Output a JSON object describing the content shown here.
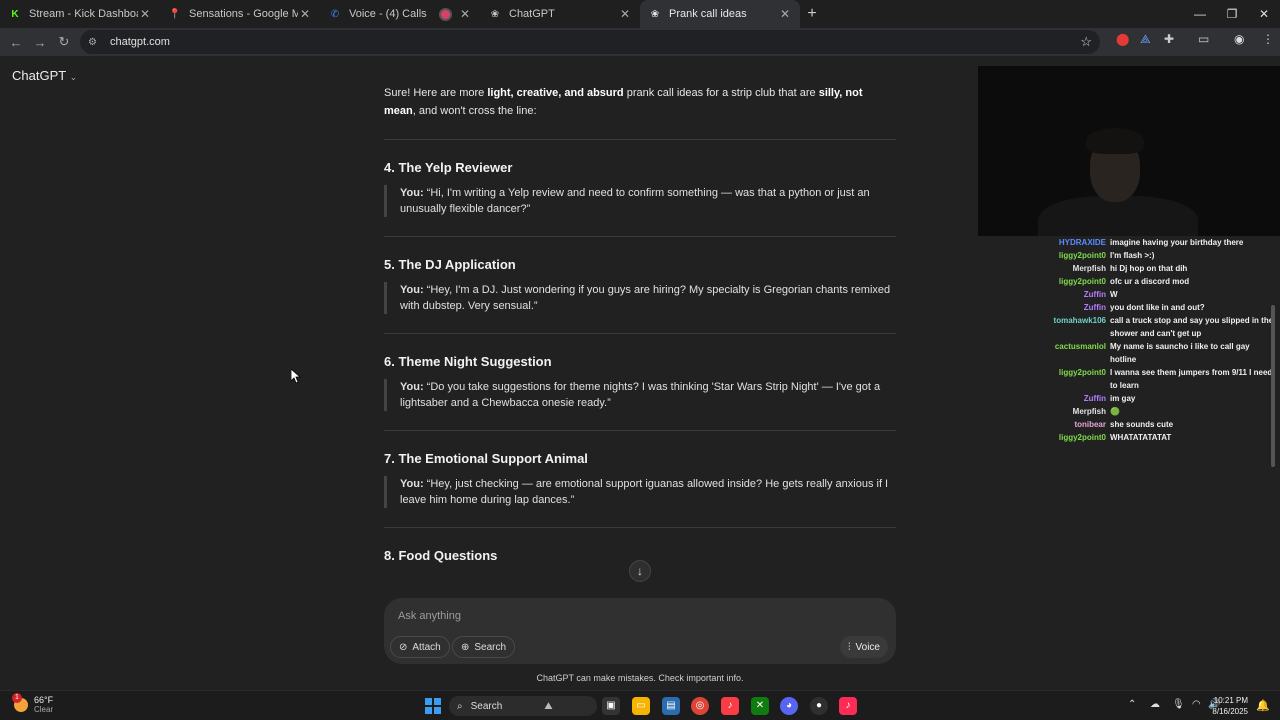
{
  "browser": {
    "tabs": [
      {
        "title": "Stream - Kick Dashboard",
        "icon": "kick-icon",
        "color": "#53fc18"
      },
      {
        "title": "Sensations - Google Maps",
        "icon": "maps-pin-icon",
        "color": "#34a853"
      },
      {
        "title": "Voice - (4) Calls",
        "icon": "voice-icon",
        "color": "#4285f4"
      },
      {
        "title": "ChatGPT",
        "icon": "openai-icon",
        "color": "#dddddd"
      },
      {
        "title": "Prank call ideas",
        "icon": "openai-icon",
        "color": "#dddddd"
      }
    ],
    "active_tab": 4,
    "url": "chatgpt.com"
  },
  "app": {
    "title": "ChatGPT"
  },
  "conversation": {
    "intro": {
      "p1": "Sure! Here are more ",
      "b1": "light, creative, and absurd",
      "p2": " prank call ideas for a strip club that are ",
      "b2": "silly, not mean",
      "p3": ", and won't cross the line:"
    },
    "ideas": [
      {
        "title": "4. The Yelp Reviewer",
        "speaker": "You:",
        "text": " “Hi, I'm writing a Yelp review and need to confirm something — was that a python or just an unusually flexible dancer?”"
      },
      {
        "title": "5. The DJ Application",
        "speaker": "You:",
        "text": " “Hey, I'm a DJ. Just wondering if you guys are hiring? My specialty is Gregorian chants remixed with dubstep. Very sensual.”"
      },
      {
        "title": "6. Theme Night Suggestion",
        "speaker": "You:",
        "text": " “Do you take suggestions for theme nights? I was thinking 'Star Wars Strip Night' — I've got a lightsaber and a Chewbacca onesie ready.”"
      },
      {
        "title": "7. The Emotional Support Animal",
        "speaker": "You:",
        "text": " “Hey, just checking — are emotional support iguanas allowed inside? He gets really anxious if I leave him home during lap dances.”"
      },
      {
        "title": "8. Food Questions",
        "speaker": "",
        "text": ""
      }
    ]
  },
  "composer": {
    "placeholder": "Ask anything",
    "attach_label": "Attach",
    "search_label": "Search",
    "voice_label": "Voice"
  },
  "disclaimer": "ChatGPT can make mistakes. Check important info.",
  "chat_overlay": {
    "messages": [
      {
        "user": "HYDRAXIDE",
        "text": "imagine having your birthday there",
        "color": "#5b8cff"
      },
      {
        "user": "liggy2point0",
        "text": "I'm flash >:)",
        "color": "#7fdc4a"
      },
      {
        "user": "Merpfish",
        "text": "hi Dj hop on that dih",
        "color": "#e0e0e0"
      },
      {
        "user": "liggy2point0",
        "text": "ofc ur a discord mod",
        "color": "#7fdc4a"
      },
      {
        "user": "Zuffin",
        "text": "W",
        "color": "#b57cff"
      },
      {
        "user": "Zuffin",
        "text": "you dont like in and out?",
        "color": "#b57cff"
      },
      {
        "user": "tomahawk106",
        "text": "call a truck stop and say you slipped in the shower and can't get up",
        "color": "#6fd1c4"
      },
      {
        "user": "cactusmanlol",
        "text": "My name is sauncho i like to call gay hotline",
        "color": "#7fdc4a"
      },
      {
        "user": "liggy2point0",
        "text": "I wanna see them jumpers from 9/11 I need to learn",
        "color": "#7fdc4a"
      },
      {
        "user": "Zuffin",
        "text": "im gay",
        "color": "#b57cff"
      },
      {
        "user": "Merpfish",
        "text": "🟢",
        "color": "#e0e0e0"
      },
      {
        "user": "tonibear",
        "text": "she sounds cute",
        "color": "#e8a4d8"
      },
      {
        "user": "liggy2point0",
        "text": "WHATATATATAT",
        "color": "#7fdc4a"
      }
    ]
  },
  "taskbar": {
    "weather_temp": "66°F",
    "weather_desc": "Clear",
    "weather_badge": "1",
    "search_label": "Search",
    "time": "10:21 PM",
    "date": "8/16/2025"
  }
}
